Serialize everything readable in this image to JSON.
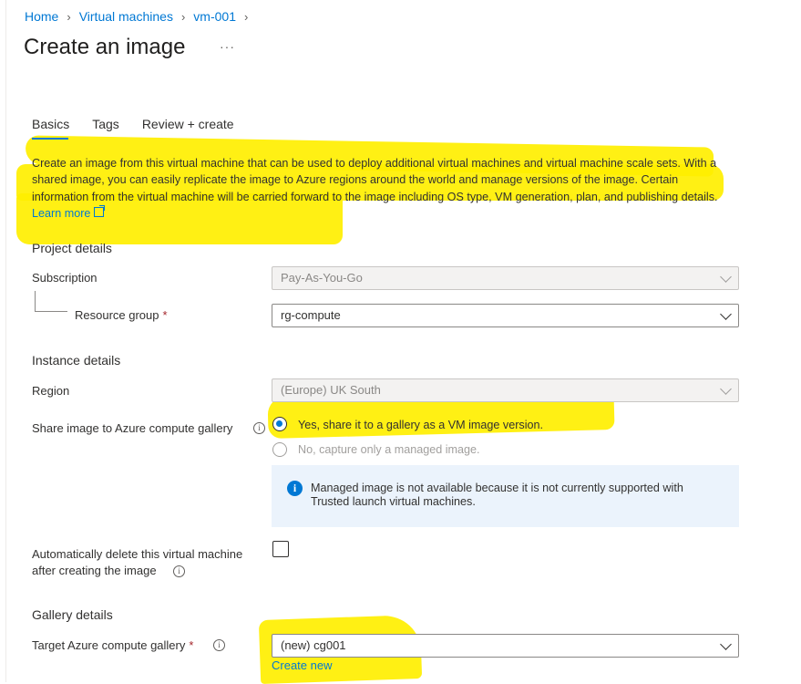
{
  "breadcrumb": [
    "Home",
    "Virtual machines",
    "vm-001"
  ],
  "page": {
    "title": "Create an image",
    "more": "···"
  },
  "tabs": [
    "Basics",
    "Tags",
    "Review + create"
  ],
  "description": {
    "text": "Create an image from this virtual machine that can be used to deploy additional virtual machines and virtual machine scale sets. With a shared image, you can easily replicate the image to Azure regions around the world and manage versions of the image. Certain information from the virtual machine will be carried forward to the image including OS type, VM generation, plan, and publishing details.",
    "link": "Learn more"
  },
  "project": {
    "heading": "Project details",
    "subscription_label": "Subscription",
    "subscription_value": "Pay-As-You-Go",
    "rg_label": "Resource group",
    "rg_value": "rg-compute",
    "required_mark": "*"
  },
  "instance": {
    "heading": "Instance details",
    "region_label": "Region",
    "region_value": "(Europe) UK South",
    "share_label": "Share image to Azure compute gallery",
    "radio_yes": "Yes, share it to a gallery as a VM image version.",
    "radio_no": "No, capture only a managed image.",
    "info_text": "Managed image is not available because it is not currently supported with Trusted launch virtual machines.",
    "autodelete_label_1": "Automatically delete this virtual machine",
    "autodelete_label_2": "after creating the image"
  },
  "gallery": {
    "heading": "Gallery details",
    "target_label": "Target Azure compute gallery",
    "required_mark": "*",
    "target_value": "(new) cg001",
    "create_new": "Create new"
  },
  "colors": {
    "accent": "#0078d4",
    "highlight": "#ffef00",
    "info_bg": "#ebf3fc",
    "required": "#a4262c"
  },
  "icons": [
    "chevron-right-icon",
    "chevron-down-icon",
    "info-icon",
    "external-link-icon"
  ]
}
